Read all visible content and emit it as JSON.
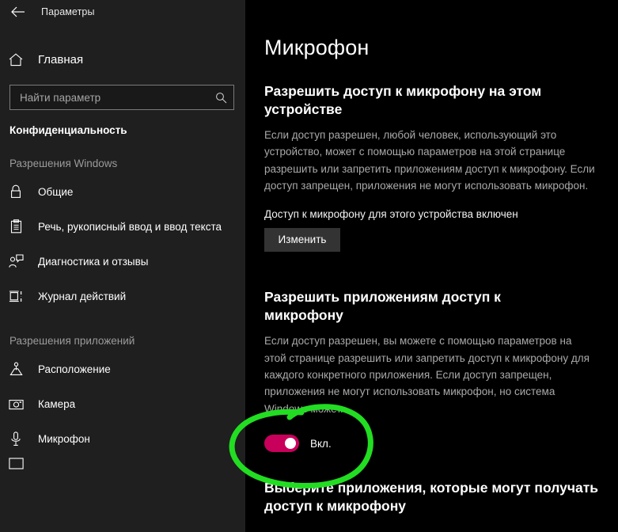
{
  "window": {
    "title": "Параметры",
    "back_icon": "back-arrow-icon"
  },
  "sidebar": {
    "home": {
      "label": "Главная",
      "icon": "home-icon"
    },
    "search": {
      "placeholder": "Найти параметр",
      "value": "",
      "icon": "search-icon"
    },
    "section_title": "Конфиденциальность",
    "groups": [
      {
        "label": "Разрешения Windows",
        "items": [
          {
            "label": "Общие",
            "icon": "lock-icon"
          },
          {
            "label": "Речь, рукописный ввод и ввод текста",
            "icon": "clipboard-icon"
          },
          {
            "label": "Диагностика и отзывы",
            "icon": "person-feedback-icon"
          },
          {
            "label": "Журнал действий",
            "icon": "activity-history-icon"
          }
        ]
      },
      {
        "label": "Разрешения приложений",
        "items": [
          {
            "label": "Расположение",
            "icon": "location-icon"
          },
          {
            "label": "Камера",
            "icon": "camera-icon"
          },
          {
            "label": "Микрофон",
            "icon": "microphone-icon"
          },
          {
            "label": "",
            "icon": "notifications-icon"
          }
        ]
      }
    ]
  },
  "main": {
    "page_title": "Микрофон",
    "device_section": {
      "heading": "Разрешить доступ к микрофону на этом устройстве",
      "description": "Если доступ разрешен, любой человек, использующий это устройство, может с помощью параметров на этой странице разрешить или запретить приложениям доступ к микрофону. Если доступ запрещен, приложения не могут использовать микрофон.",
      "status": "Доступ к микрофону для этого устройства включен",
      "change_button": "Изменить"
    },
    "apps_section": {
      "heading": "Разрешить приложениям доступ к микрофону",
      "description": "Если доступ разрешен, вы можете с помощью параметров на этой странице разрешить или запретить доступ к микрофону для каждого конкретного приложения. Если доступ запрещен, приложения не могут использовать микрофон, но система Windows может.",
      "toggle_label": "Вкл.",
      "toggle_state": "on"
    },
    "choose_apps_heading": "Выберите приложения, которые могут получать доступ к микрофону"
  },
  "annotation": {
    "shape": "hand-drawn-ellipse",
    "color": "#22dd22",
    "target": "microphone-apps-toggle"
  },
  "colors": {
    "sidebar_bg": "#1f1f1f",
    "main_bg": "#000000",
    "accent": "#c8005c",
    "button_bg": "#333333",
    "muted_text": "#a9a9a9",
    "annotation_green": "#22dd22"
  }
}
